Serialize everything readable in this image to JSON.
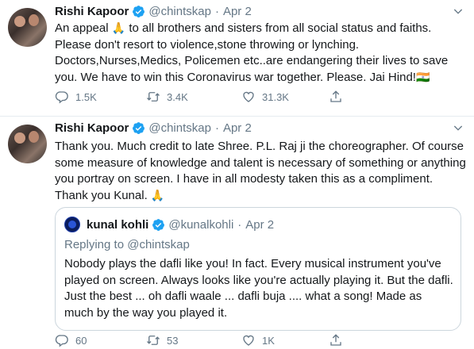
{
  "tweets": [
    {
      "author_name": "Rishi Kapoor",
      "handle": "@chintskap",
      "separator": "·",
      "date": "Apr 2",
      "text_main": "An appeal ",
      "emoji_1": "🙏",
      "text_rest": " to all brothers and sisters from all social status and faiths. Please don't resort to violence,stone throwing or lynching. Doctors,Nurses,Medics, Policemen etc..are endangering their lives to save you. We have to win this Coronavirus war together. Please. Jai Hind!",
      "emoji_2": "🇮🇳",
      "replies": "1.5K",
      "retweets": "3.4K",
      "likes": "31.3K"
    },
    {
      "author_name": "Rishi Kapoor",
      "handle": "@chintskap",
      "separator": "·",
      "date": "Apr 2",
      "text_main": "Thank you. Much credit to late Shree. P.L. Raj ji the choreographer. Of course some measure of knowledge and talent is necessary of something or anything you portray on screen. I have in all modesty taken this as a compliment. Thank you Kunal. ",
      "emoji_1": "🙏",
      "replies": "60",
      "retweets": "53",
      "likes": "1K",
      "quote": {
        "author_name": "kunal kohli",
        "handle": "@kunalkohli",
        "separator": "·",
        "date": "Apr 2",
        "replying_to_label": "Replying to",
        "replying_to_handle": "@chintskap",
        "text": "Nobody plays the dafli like you! In fact. Every musical instrument you've played on screen. Always looks like you're actually playing it. But the dafli. Just the best ... oh dafli waale ... dafli buja .... what a song! Made as much by the way you played it."
      }
    }
  ],
  "colors": {
    "verified": "#1da1f2",
    "secondary_text": "#657786",
    "border": "#ccd6dd"
  },
  "icons": [
    "verified-badge-icon",
    "chevron-down-icon",
    "reply-icon",
    "retweet-icon",
    "like-icon",
    "share-icon"
  ]
}
